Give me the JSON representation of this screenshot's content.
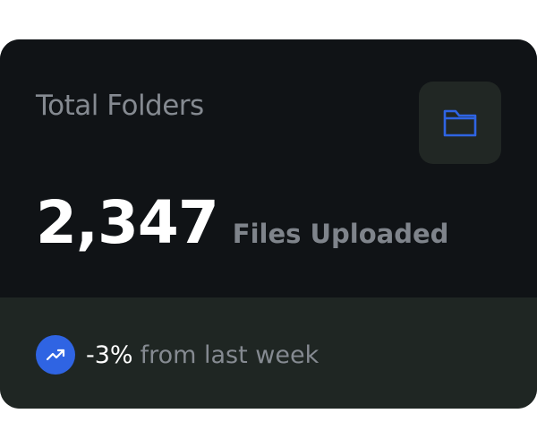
{
  "card": {
    "title": "Total Folders",
    "value": "2,347",
    "value_caption": "Files Uploaded",
    "trend": {
      "value": "-3%",
      "caption": "from last week"
    }
  },
  "icons": {
    "folder": "folder-icon",
    "trend": "trending-up-icon"
  },
  "colors": {
    "card_background": "#101316",
    "footer_background": "#1f2623",
    "icon_box_background": "#212724",
    "accent_blue": "#2f64e3",
    "muted_text": "#858a91",
    "primary_text": "#ffffff"
  }
}
